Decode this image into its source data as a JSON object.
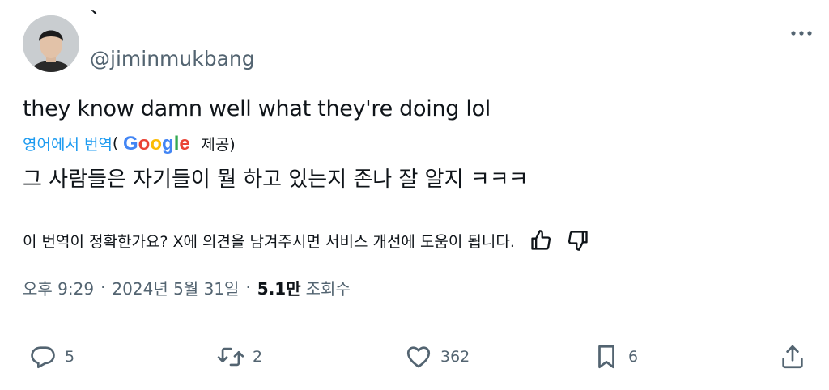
{
  "author": {
    "display_name": "`",
    "handle": "@jiminmukbang"
  },
  "tweet": {
    "text": "they know damn well what they're doing lol"
  },
  "translation_bar": {
    "link_label": "영어에서 번역",
    "open_paren": "(",
    "google_label": "Google",
    "provided_label": "제공)"
  },
  "translation": {
    "text": "그 사람들은 자기들이 뭘 하고 있는지 존나 잘 알지 ㅋㅋㅋ"
  },
  "feedback": {
    "prompt": "이 번역이 정확한가요? X에 의견을 남겨주시면 서비스 개선에 도움이 됩니다."
  },
  "meta": {
    "time": "오후 9:29",
    "separator": "·",
    "date": "2024년 5월 31일",
    "views_count": "5.1만",
    "views_label": "조회수"
  },
  "actions": {
    "replies": "5",
    "retweets": "2",
    "likes": "362",
    "bookmarks": "6"
  },
  "icons": [
    "more-options-icon",
    "thumbs-up-icon",
    "thumbs-down-icon",
    "reply-icon",
    "retweet-icon",
    "like-icon",
    "bookmark-icon",
    "share-icon"
  ],
  "colors": {
    "link": "#1d9bf0",
    "secondary_text": "#536471",
    "primary_text": "#0f1419"
  }
}
